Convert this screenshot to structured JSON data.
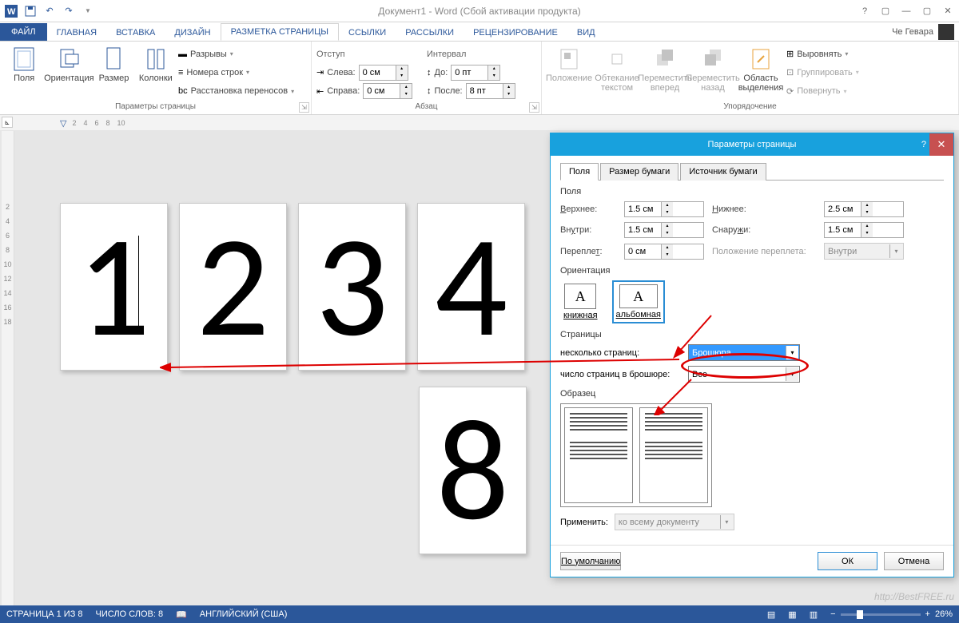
{
  "titlebar": {
    "title": "Документ1 - Word (Сбой активации продукта)"
  },
  "tabs": {
    "file": "ФАЙЛ",
    "items": [
      "ГЛАВНАЯ",
      "ВСТАВКА",
      "ДИЗАЙН",
      "РАЗМЕТКА СТРАНИЦЫ",
      "ССЫЛКИ",
      "РАССЫЛКИ",
      "РЕЦЕНЗИРОВАНИЕ",
      "ВИД"
    ],
    "active": "РАЗМЕТКА СТРАНИЦЫ",
    "user": "Че Гевара"
  },
  "ribbon": {
    "page_setup": {
      "margins": "Поля",
      "orientation": "Ориентация",
      "size": "Размер",
      "columns": "Колонки",
      "breaks": "Разрывы",
      "line_numbers": "Номера строк",
      "hyphenation": "Расстановка переносов",
      "group_label": "Параметры страницы"
    },
    "paragraph": {
      "indent_label": "Отступ",
      "left_label": "Слева:",
      "left_value": "0 см",
      "right_label": "Справа:",
      "right_value": "0 см",
      "spacing_label": "Интервал",
      "before_label": "До:",
      "before_value": "0 пт",
      "after_label": "После:",
      "after_value": "8 пт",
      "group_label": "Абзац"
    },
    "arrange": {
      "position": "Положение",
      "wrap": "Обтекание текстом",
      "forward": "Переместить вперед",
      "backward": "Переместить назад",
      "selection_pane": "Область выделения",
      "align": "Выровнять",
      "group": "Группировать",
      "rotate": "Повернуть",
      "group_label": "Упорядочение"
    }
  },
  "ruler_h": [
    "2",
    "4",
    "6",
    "8",
    "10"
  ],
  "ruler_v": [
    "2",
    "4",
    "6",
    "8",
    "10",
    "12",
    "14",
    "16",
    "18"
  ],
  "pages": [
    "1",
    "2",
    "3",
    "4"
  ],
  "page_extra": "8",
  "dialog": {
    "title": "Параметры страницы",
    "tabs": {
      "margins": "Поля",
      "paper": "Размер бумаги",
      "source": "Источник бумаги"
    },
    "margins_section": "Поля",
    "top_label": "Верхнее:",
    "top_value": "1.5 см",
    "bottom_label": "Нижнее:",
    "bottom_value": "2.5 см",
    "inside_label": "Внутри:",
    "inside_value": "1.5 см",
    "outside_label": "Снаружи:",
    "outside_value": "1.5 см",
    "gutter_label": "Переплет:",
    "gutter_value": "0 см",
    "gutter_pos_label": "Положение переплета:",
    "gutter_pos_value": "Внутри",
    "orientation_label": "Ориентация",
    "portrait": "книжная",
    "landscape": "альбомная",
    "pages_label": "Страницы",
    "multi_pages_label": "несколько страниц:",
    "multi_pages_value": "Брошюра",
    "sheets_label": "число страниц в брошюре:",
    "sheets_value": "Все",
    "preview_label": "Образец",
    "apply_label": "Применить:",
    "apply_value": "ко всему документу",
    "default_btn": "По умолчанию",
    "ok_btn": "ОК",
    "cancel_btn": "Отмена"
  },
  "statusbar": {
    "page": "СТРАНИЦА 1 ИЗ 8",
    "words": "ЧИСЛО СЛОВ: 8",
    "lang": "АНГЛИЙСКИЙ (США)",
    "zoom": "26%"
  },
  "watermark": "http://BestFREE.ru"
}
